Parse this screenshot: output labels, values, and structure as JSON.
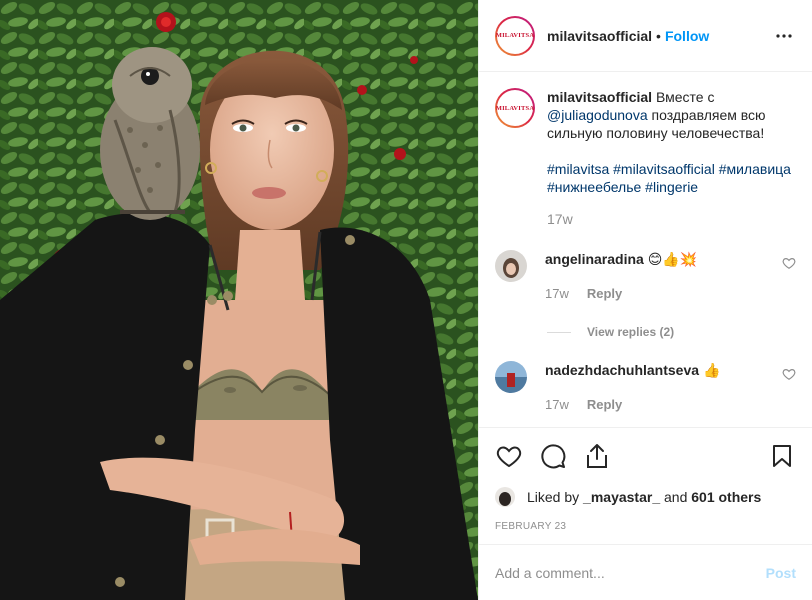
{
  "post": {
    "username": "milavitsaofficial",
    "follow_label": "Follow",
    "separator": "•",
    "brand_logo_text": "MILAVITSA",
    "caption": {
      "username": "milavitsaofficial",
      "text_before": "Вместе с",
      "mention": "@juliagodunova",
      "text_after": "поздравляем всю сильную половину человечества!",
      "hashtags": "#milavitsa #milavitsaofficial #милавица #нижнеебелье #lingerie",
      "age": "17w"
    },
    "comments": [
      {
        "username": "angelinaradina",
        "text": "😊👍💥",
        "age": "17w",
        "reply_label": "Reply"
      },
      {
        "username": "nadezhdachuhlantseva",
        "text": "👍",
        "age": "17w",
        "reply_label": "Reply"
      }
    ],
    "view_replies": "View replies (2)",
    "likes": {
      "prefix": "Liked by",
      "user": "_mayastar_",
      "middle": "and",
      "count": "601 others"
    },
    "date": "FEBRUARY 23",
    "comment_placeholder": "Add a comment...",
    "post_label": "Post"
  },
  "icons": {
    "more": "more-options-icon",
    "like": "heart-icon",
    "comment": "comment-icon",
    "share": "share-icon",
    "save": "bookmark-icon"
  },
  "colors": {
    "link_blue": "#0095f6",
    "mention_blue": "#00376b",
    "muted": "#8e8e8e",
    "post_disabled": "#b2dffc",
    "brand_red": "#c8102e"
  }
}
